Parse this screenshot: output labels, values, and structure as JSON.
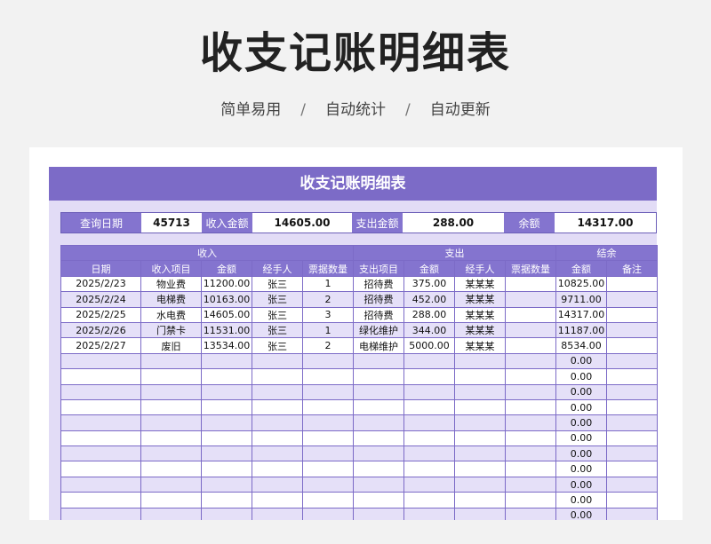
{
  "header": {
    "title": "收支记账明细表",
    "tags": [
      "简单易用",
      "自动统计",
      "自动更新"
    ],
    "separator": "/"
  },
  "sheet": {
    "banner": "收支记账明细表",
    "summary": {
      "query_date_label": "查询日期",
      "query_date_value": "45713",
      "income_label": "收入金额",
      "income_value": "14605.00",
      "expense_label": "支出金额",
      "expense_value": "288.00",
      "balance_label": "余额",
      "balance_value": "14317.00"
    },
    "groups": {
      "income": "收入",
      "expense": "支出",
      "balance": "结余"
    },
    "columns": [
      "日期",
      "收入项目",
      "金额",
      "经手人",
      "票据数量",
      "支出项目",
      "金额",
      "经手人",
      "票据数量",
      "金额",
      "备注"
    ],
    "rows": [
      [
        "2025/2/23",
        "物业费",
        "11200.00",
        "张三",
        "1",
        "招待费",
        "375.00",
        "某某某",
        "",
        "10825.00",
        ""
      ],
      [
        "2025/2/24",
        "电梯费",
        "10163.00",
        "张三",
        "2",
        "招待费",
        "452.00",
        "某某某",
        "",
        "9711.00",
        ""
      ],
      [
        "2025/2/25",
        "水电费",
        "14605.00",
        "张三",
        "3",
        "招待费",
        "288.00",
        "某某某",
        "",
        "14317.00",
        ""
      ],
      [
        "2025/2/26",
        "门禁卡",
        "11531.00",
        "张三",
        "1",
        "绿化维护",
        "344.00",
        "某某某",
        "",
        "11187.00",
        ""
      ],
      [
        "2025/2/27",
        "废旧",
        "13534.00",
        "张三",
        "2",
        "电梯维护",
        "5000.00",
        "某某某",
        "",
        "8534.00",
        ""
      ],
      [
        "",
        "",
        "",
        "",
        "",
        "",
        "",
        "",
        "",
        "0.00",
        ""
      ],
      [
        "",
        "",
        "",
        "",
        "",
        "",
        "",
        "",
        "",
        "0.00",
        ""
      ],
      [
        "",
        "",
        "",
        "",
        "",
        "",
        "",
        "",
        "",
        "0.00",
        ""
      ],
      [
        "",
        "",
        "",
        "",
        "",
        "",
        "",
        "",
        "",
        "0.00",
        ""
      ],
      [
        "",
        "",
        "",
        "",
        "",
        "",
        "",
        "",
        "",
        "0.00",
        ""
      ],
      [
        "",
        "",
        "",
        "",
        "",
        "",
        "",
        "",
        "",
        "0.00",
        ""
      ],
      [
        "",
        "",
        "",
        "",
        "",
        "",
        "",
        "",
        "",
        "0.00",
        ""
      ],
      [
        "",
        "",
        "",
        "",
        "",
        "",
        "",
        "",
        "",
        "0.00",
        ""
      ],
      [
        "",
        "",
        "",
        "",
        "",
        "",
        "",
        "",
        "",
        "0.00",
        ""
      ],
      [
        "",
        "",
        "",
        "",
        "",
        "",
        "",
        "",
        "",
        "0.00",
        ""
      ],
      [
        "",
        "",
        "",
        "",
        "",
        "",
        "",
        "",
        "",
        "0.00",
        ""
      ]
    ]
  },
  "colors": {
    "accent": "#7c6bc7",
    "header_fill": "#8474cf",
    "band": "#e5e0f8"
  }
}
